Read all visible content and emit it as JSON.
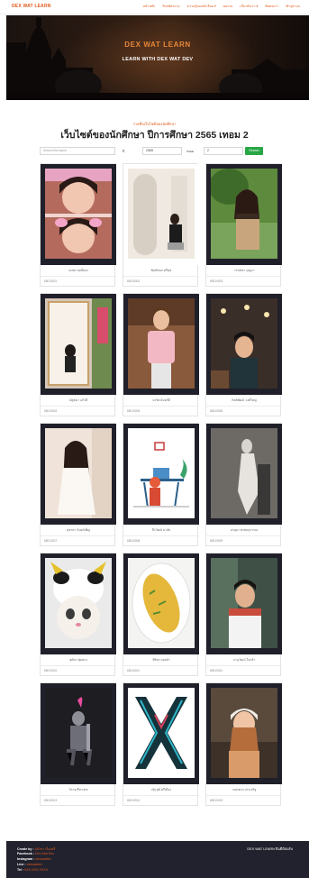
{
  "navbar": {
    "brand": "DEX WAT LEARN",
    "links": [
      "หน้าหลัก",
      "รับสมัครงาน",
      "ความรู้ของนักเรียน ▾",
      "ผลงาน",
      "เกี่ยวกับเรา ▾",
      "ติดต่อเรา",
      "เข้าสู่ระบบ"
    ]
  },
  "hero": {
    "title": "DEX WAT LEARN",
    "subtitle": "LEARN WITH DEX WAT DEV"
  },
  "section": {
    "kicker": "รายชื่อเว็บไซต์ของนักศึกษา",
    "title": "เว็บไซต์ของนักศึกษา ปีการศึกษา 2565 เทอม 2"
  },
  "search": {
    "placeholder": "Search first name",
    "year_label": "ปี",
    "year_value": "2565",
    "term_label": "เทอม",
    "term_value": "2",
    "button": "Search"
  },
  "students": [
    {
      "name": "ธนพร ฤทธิ์ทอง",
      "code": "65010001",
      "photo": "selfie-duo",
      "frame": "#20202a"
    },
    {
      "name": "พิมพ์ชนก ศรีสุข",
      "code": "65010002",
      "photo": "mirror-room",
      "frame": "#ffffff"
    },
    {
      "name": "วรรณิสา บุญมา",
      "code": "65010003",
      "photo": "outdoor-tree",
      "frame": "#20202a"
    },
    {
      "name": "ณัฐธิดา แก้วดี",
      "code": "65010004",
      "photo": "mirror-selfie",
      "frame": "#20202a"
    },
    {
      "name": "ปวริศ อินทร์ดี",
      "code": "65010005",
      "photo": "man-pink-shirt",
      "frame": "#20202a"
    },
    {
      "name": "กิตติพัฒน์ วงศ์ใหญ่",
      "code": "65010006",
      "photo": "cafe-portrait",
      "frame": "#20202a"
    },
    {
      "name": "สุชาดา จันทร์เพ็ญ",
      "code": "65010007",
      "photo": "woman-white-dress",
      "frame": "#20202a"
    },
    {
      "name": "ธีรวัฒน์ มาลัย",
      "code": "65010008",
      "photo": "desk-illustration",
      "frame": "#20202a"
    },
    {
      "name": "อรอุมา พรหมสุวรรณ",
      "code": "65010009",
      "photo": "bw-figure",
      "frame": "#20202a"
    },
    {
      "name": "ชุติมา พุ่มพวง",
      "code": "65010010",
      "photo": "cat-costume",
      "frame": "#20202a"
    },
    {
      "name": "ศิริพร ทองคำ",
      "code": "65010011",
      "photo": "omelette",
      "frame": "#20202a"
    },
    {
      "name": "ภานุวัฒน์ ใจกล้า",
      "code": "65010012",
      "photo": "young-man",
      "frame": "#20202a"
    },
    {
      "name": "จิรายุ สีหาเดช",
      "code": "65010013",
      "photo": "knight-figure",
      "frame": "#20202a"
    },
    {
      "name": "ณัฐวุฒิ ศรีเมือง",
      "code": "65010014",
      "photo": "x-logo",
      "frame": "#20202a"
    },
    {
      "name": "กมลชนก ประเสริฐ",
      "code": "65010015",
      "photo": "woman-beanie",
      "frame": "#20202a"
    }
  ],
  "footer": {
    "rows": [
      {
        "label": "Create by :",
        "value": "ปภังกร เรืองศรี"
      },
      {
        "label": "Facebook :",
        "value": "Dex Wat Dev"
      },
      {
        "label": "Instagram :",
        "value": "dexwatdev"
      },
      {
        "label": "Line :",
        "value": "dexwatdev"
      },
      {
        "label": "Tel :",
        "value": "0XX-XXX-XXXX"
      }
    ],
    "right_text": "DEX WAT LEARN ยินดีต้อนรับ"
  }
}
